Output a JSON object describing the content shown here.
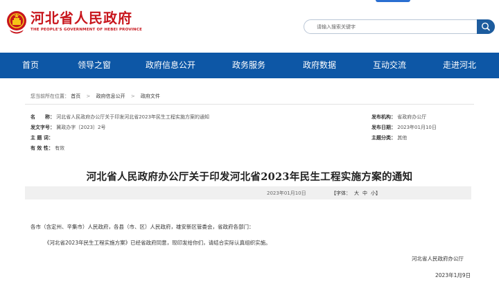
{
  "header": {
    "logo_cn": "河北省人民政府",
    "logo_en": "THE PEOPLE'S GOVERNMENT OF HEBEI PROVINCE",
    "search_placeholder": "请输入搜索关键字",
    "brand_color": "#c8161d"
  },
  "nav": {
    "bg_color": "#0d57a6",
    "items": [
      {
        "label": "首页"
      },
      {
        "label": "领导之窗"
      },
      {
        "label": "政府信息公开"
      },
      {
        "label": "政务服务"
      },
      {
        "label": "政府数据"
      },
      {
        "label": "互动交流"
      },
      {
        "label": "走进河北"
      }
    ]
  },
  "breadcrumb": {
    "prefix": "您当前所在位置：",
    "items": [
      "首页",
      "政府信息公开",
      "政府文件"
    ]
  },
  "meta": {
    "name_label": "名　　称：",
    "name_value": "河北省人民政府办公厅关于印发河北省2023年民生工程实施方案的通知",
    "doc_no_label": "发文字号：",
    "doc_no_value": "冀政办字〔2023〕2号",
    "topic_label": "主 题 词：",
    "topic_value": "",
    "validity_label": "有 效 性：",
    "validity_value": "有效",
    "publisher_label": "发布机构：",
    "publisher_value": "省政府办公厅",
    "pubdate_label": "发布日期：",
    "pubdate_value": "2023年01月10日",
    "category_label": "主题分类：",
    "category_value": "其他"
  },
  "article": {
    "title": "河北省人民政府办公厅关于印发河北省2023年民生工程实施方案的通知",
    "date": "2023年01月10日",
    "font_label": "【字体：",
    "font_large": "大",
    "font_medium": "中",
    "font_small": "小】",
    "salutation": "各市（含定州、辛集市）人民政府，各县（市、区）人民政府，雄安新区管委会，省政府各部门：",
    "body": "《河北省2023年民生工程实施方案》已经省政府同意，现印发给你们，请结合实际认真组织实施。",
    "signer": "河北省人民政府办公厅",
    "sign_date": "2023年1月9日"
  }
}
